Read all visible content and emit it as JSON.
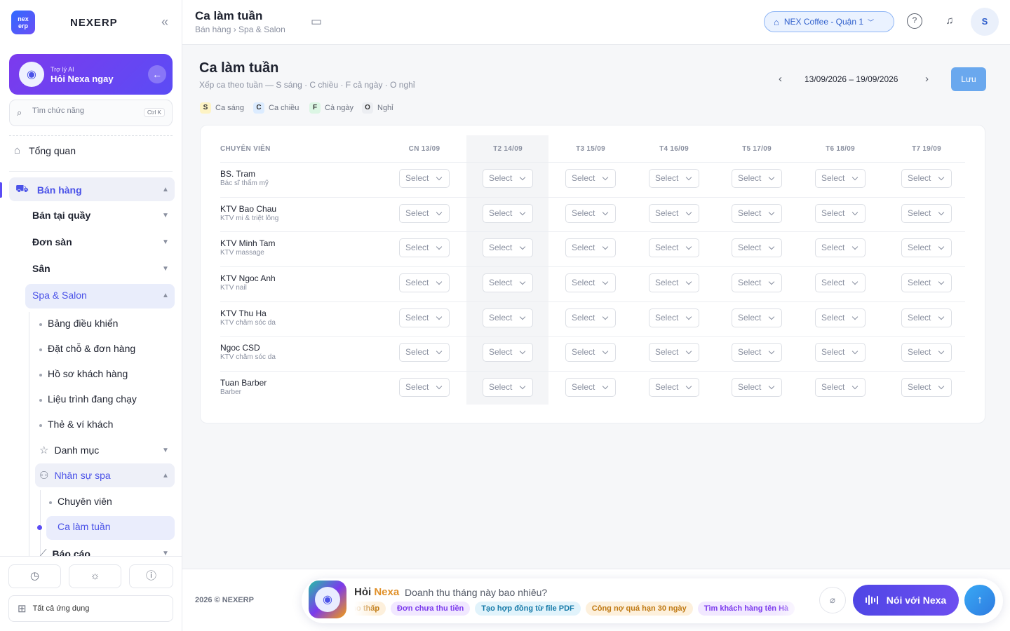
{
  "sidebar": {
    "logo_text": "nex erp",
    "brand": "NEXERP",
    "collapse_icon": "«",
    "ai": {
      "small": "Trợ lý AI",
      "big": "Hỏi Nexa ngay"
    },
    "search": {
      "placeholder": "Tìm chức năng",
      "shortcut": "Ctrl K"
    },
    "overview": "Tổng quan",
    "sales": "Bán hàng",
    "sub_items": [
      "Bán tại quầy",
      "Đơn sàn",
      "Sân"
    ],
    "spa": "Spa & Salon",
    "spa_items": [
      "Bảng điều khiển",
      "Đặt chỗ & đơn hàng",
      "Hồ sơ khách hàng",
      "Liệu trình đang chạy",
      "Thẻ & ví khách"
    ],
    "catalog": "Danh mục",
    "staff": "Nhân sự spa",
    "staff_items": [
      "Chuyên viên",
      "Ca làm tuần"
    ],
    "reports": "Báo cáo",
    "all_apps": "Tất cả ứng dụng"
  },
  "topbar": {
    "title": "Ca làm tuần",
    "breadcrumb": "Bán hàng › Spa & Salon",
    "store": "NEX Coffee - Quận 1",
    "avatar": "S"
  },
  "page": {
    "title": "Ca làm tuần",
    "subtitle": "Xếp ca theo tuần — S sáng · C chiều · F cả ngày · O nghỉ",
    "legend": [
      {
        "key": "S",
        "label": "Ca sáng",
        "color": "#fdf3c4"
      },
      {
        "key": "C",
        "label": "Ca chiều",
        "color": "#dcecff"
      },
      {
        "key": "F",
        "label": "Cả ngày",
        "color": "#dcf6e4"
      },
      {
        "key": "O",
        "label": "Nghỉ",
        "color": "#eceef2"
      }
    ],
    "date_range": "13/09/2026 – 19/09/2026",
    "save": "Lưu"
  },
  "table": {
    "header": "CHUYÊN VIÊN",
    "days": [
      "CN 13/09",
      "T2 14/09",
      "T3 15/09",
      "T4 16/09",
      "T5 17/09",
      "T6 18/09",
      "T7 19/09"
    ],
    "select_placeholder": "Select",
    "rows": [
      {
        "name": "BS. Tram",
        "role": "Bác sĩ thẩm mỹ"
      },
      {
        "name": "KTV Bao Chau",
        "role": "KTV mi & triệt lông"
      },
      {
        "name": "KTV Minh Tam",
        "role": "KTV massage"
      },
      {
        "name": "KTV Ngoc Anh",
        "role": "KTV nail"
      },
      {
        "name": "KTV Thu Ha",
        "role": "KTV chăm sóc da"
      },
      {
        "name": "Ngoc CSD",
        "role": "KTV chăm sóc da"
      },
      {
        "name": "Tuan Barber",
        "role": "Barber"
      }
    ]
  },
  "footer": {
    "copyright": "2026 © NEXERP",
    "ask_prefix": "Hỏi",
    "ask_brand": "Nexa",
    "ask_placeholder": "Doanh thu tháng này bao nhiêu?",
    "chips": [
      {
        "label": "Tồn kho thấp",
        "bg": "#fdf0dc",
        "fg": "#c07a14"
      },
      {
        "label": "Đơn chưa thu tiền",
        "bg": "#f1e8ff",
        "fg": "#7c3aed"
      },
      {
        "label": "Tạo hợp đồng từ file PDF",
        "bg": "#e1f3fb",
        "fg": "#167aa8"
      },
      {
        "label": "Công nợ quá hạn 30 ngày",
        "bg": "#fdf0dc",
        "fg": "#c07a14"
      },
      {
        "label": "Tìm khách hàng tên Hà",
        "bg": "#f1e8ff",
        "fg": "#7c3aed"
      }
    ],
    "talk": "Nói với Nexa"
  }
}
